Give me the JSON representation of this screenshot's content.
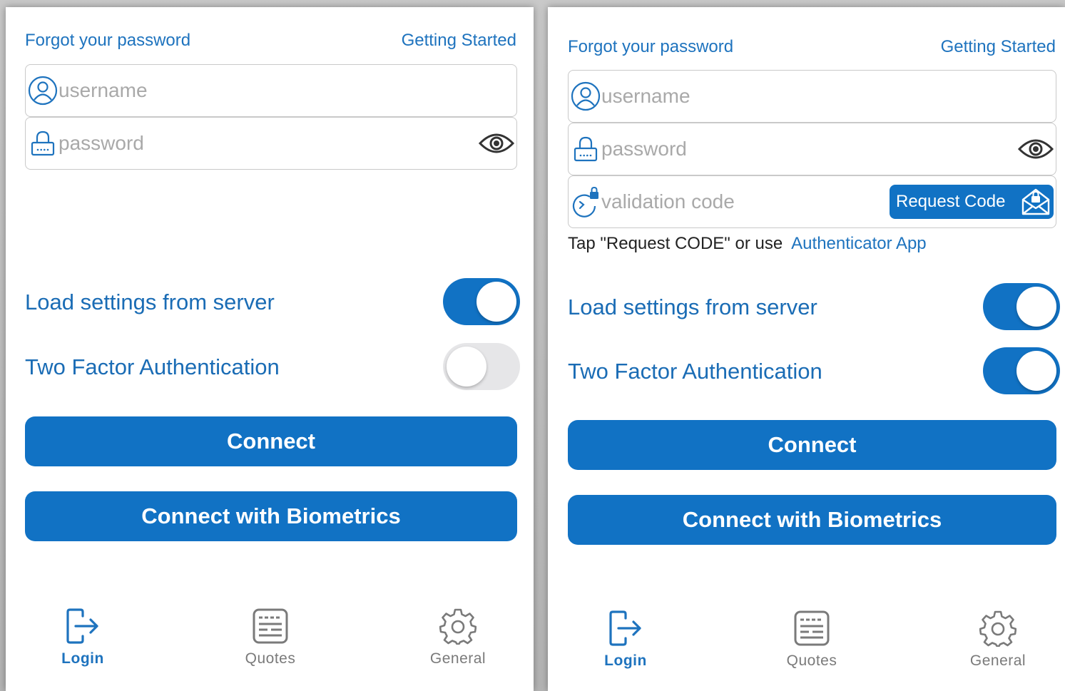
{
  "screens": [
    {
      "forgot_link": "Forgot your password",
      "getting_started_link": "Getting Started",
      "username_placeholder": "username",
      "password_placeholder": "password",
      "load_settings_label": "Load settings from server",
      "load_settings_on": true,
      "two_factor_label": "Two Factor Authentication",
      "two_factor_on": false,
      "connect_label": "Connect",
      "biometrics_label": "Connect with Biometrics",
      "tabs": [
        {
          "label": "Login",
          "icon": "login-icon",
          "active": true
        },
        {
          "label": "Quotes",
          "icon": "quotes-icon",
          "active": false
        },
        {
          "label": "General",
          "icon": "gear-icon",
          "active": false
        }
      ]
    },
    {
      "forgot_link": "Forgot your password",
      "getting_started_link": "Getting Started",
      "username_placeholder": "username",
      "password_placeholder": "password",
      "validation_placeholder": "validation code",
      "request_code_label": "Request Code",
      "hint_text": "Tap \"Request CODE\" or use",
      "authenticator_link": "Authenticator App",
      "load_settings_label": "Load settings from server",
      "load_settings_on": true,
      "two_factor_label": "Two Factor Authentication",
      "two_factor_on": true,
      "connect_label": "Connect",
      "biometrics_label": "Connect with Biometrics",
      "tabs": [
        {
          "label": "Login",
          "icon": "login-icon",
          "active": true
        },
        {
          "label": "Quotes",
          "icon": "quotes-icon",
          "active": false
        },
        {
          "label": "General",
          "icon": "gear-icon",
          "active": false
        }
      ]
    }
  ],
  "colors": {
    "accent": "#1172c4",
    "link": "#1e73be",
    "toggle_off": "#e6e6e8",
    "muted": "#7a7a7a"
  }
}
